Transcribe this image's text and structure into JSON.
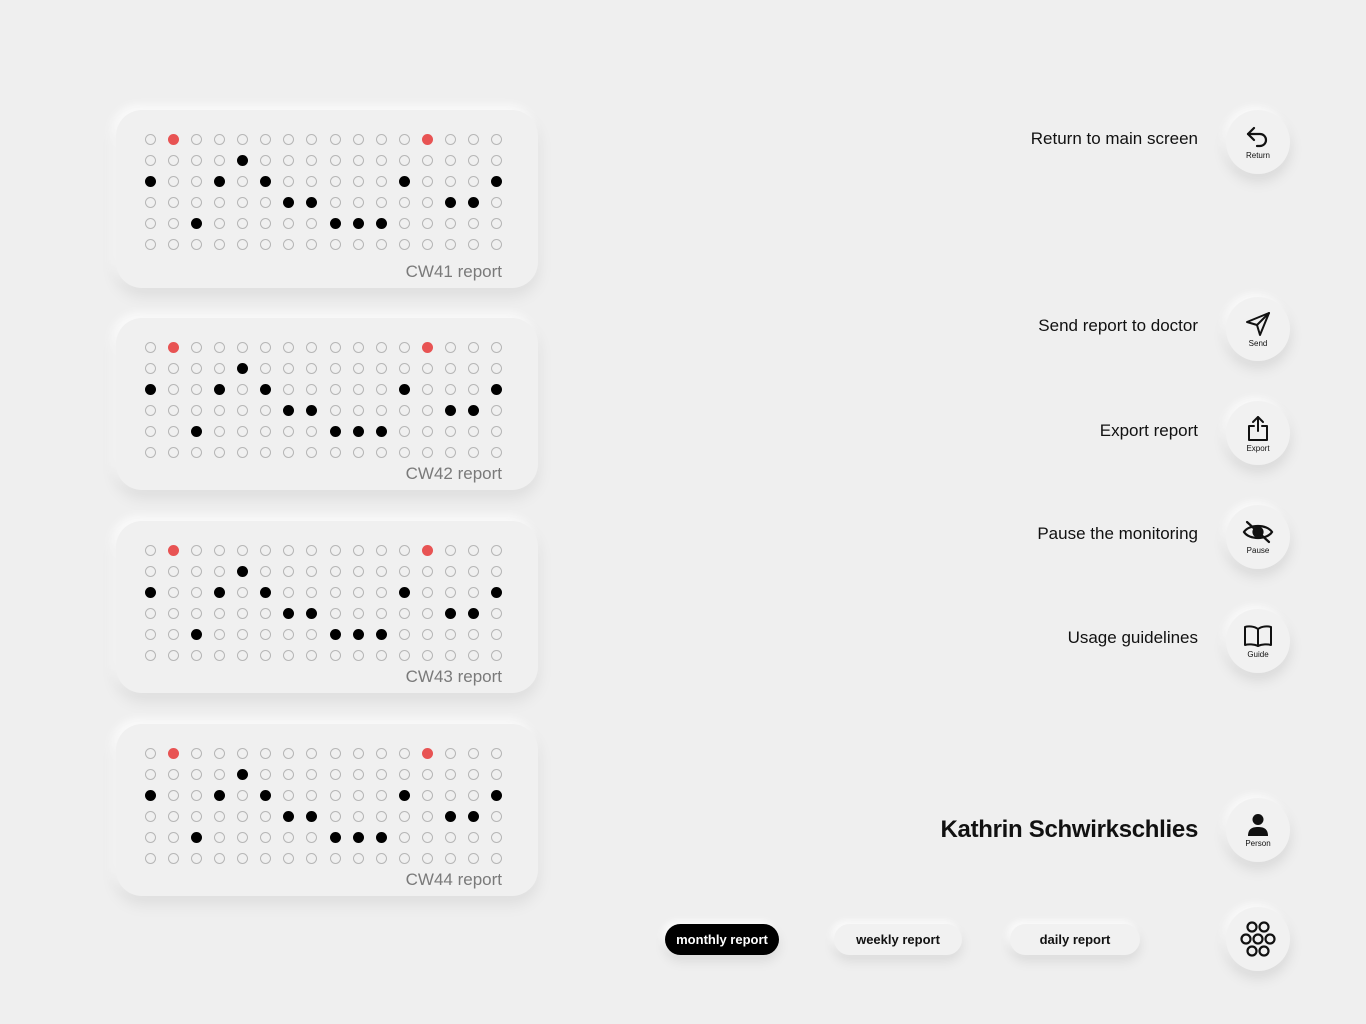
{
  "report_pattern": {
    "rows": [
      [
        0,
        2,
        0,
        0,
        0,
        0,
        0,
        0,
        0,
        0,
        0,
        0,
        2,
        0,
        0,
        0
      ],
      [
        0,
        0,
        0,
        0,
        1,
        0,
        0,
        0,
        0,
        0,
        0,
        0,
        0,
        0,
        0,
        0
      ],
      [
        1,
        0,
        0,
        1,
        0,
        1,
        0,
        0,
        0,
        0,
        0,
        1,
        0,
        0,
        0,
        1
      ],
      [
        0,
        0,
        0,
        0,
        0,
        0,
        1,
        1,
        0,
        0,
        0,
        0,
        0,
        1,
        1,
        0
      ],
      [
        0,
        0,
        1,
        0,
        0,
        0,
        0,
        0,
        1,
        1,
        1,
        0,
        0,
        0,
        0,
        0
      ],
      [
        0,
        0,
        0,
        0,
        0,
        0,
        0,
        0,
        0,
        0,
        0,
        0,
        0,
        0,
        0,
        0
      ]
    ]
  },
  "reports": [
    {
      "label": "CW41 report"
    },
    {
      "label": "CW42 report"
    },
    {
      "label": "CW43 report"
    },
    {
      "label": "CW44 report"
    }
  ],
  "colors": {
    "dot_on": "#000000",
    "dot_highlight": "#e85353",
    "dot_off_outline": "#b6b6b6"
  },
  "actions": {
    "return": {
      "label": "Return to main screen",
      "icon": "return-arrow-icon",
      "caption": "Return"
    },
    "send": {
      "label": "Send report to doctor",
      "icon": "paper-plane-icon",
      "caption": "Send"
    },
    "export": {
      "label": "Export report",
      "icon": "share-export-icon",
      "caption": "Export"
    },
    "pause": {
      "label": "Pause the monitoring",
      "icon": "eye-slash-icon",
      "caption": "Pause"
    },
    "guide": {
      "label": "Usage guidelines",
      "icon": "book-icon",
      "caption": "Guide"
    }
  },
  "person": {
    "name": "Kathrin Schwirkschlies",
    "icon": "person-icon",
    "caption": "Person"
  },
  "tabs": [
    {
      "label": "monthly report",
      "active": true
    },
    {
      "label": "weekly report",
      "active": false
    },
    {
      "label": "daily report",
      "active": false
    }
  ],
  "menu_icon": "flower-menu-icon"
}
